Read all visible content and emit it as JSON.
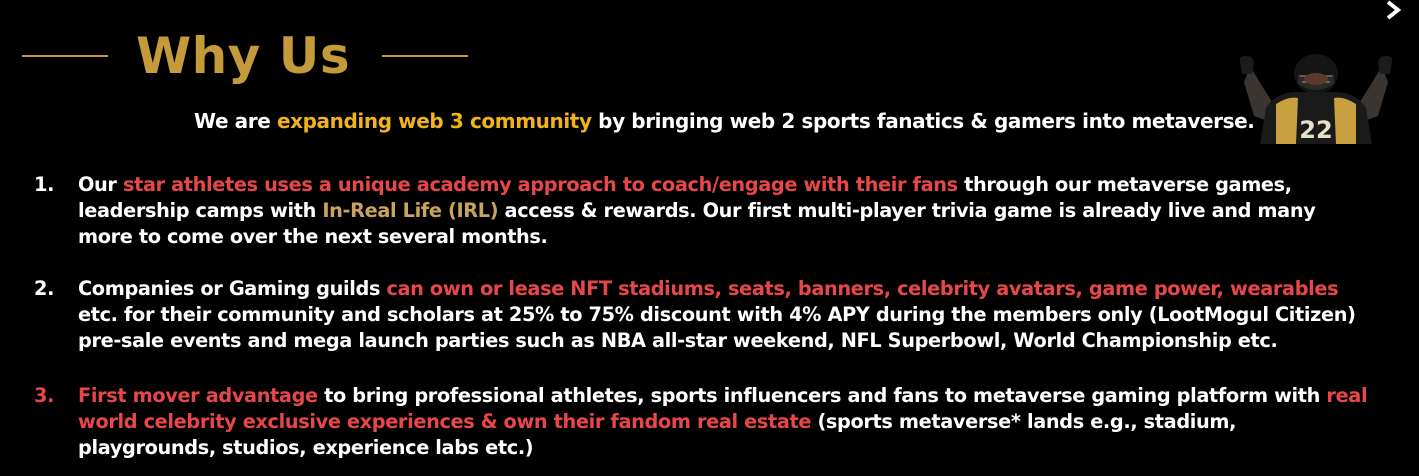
{
  "slide": {
    "title": "Why Us",
    "subtitle": {
      "prefix": "We are ",
      "highlight": "expanding web 3 community",
      "suffix": " by bringing web 2 sports fanatics & gamers into metaverse."
    },
    "jersey_number": "22",
    "colors": {
      "background": "#000000",
      "title_gold": "#c49a3a",
      "highlight_gold": "#f2b21b",
      "highlight_red": "#e8474a",
      "highlight_tan": "#c9a45c",
      "text": "#ffffff"
    },
    "icons": {
      "corner": "chevron-right-icon",
      "image": "football-player-image"
    },
    "points": [
      {
        "number": "1.",
        "line1_red": "star athletes uses a unique academy approach to coach/engage with their fans",
        "line1_prefix": "Our ",
        "line1_suffix": " through our metaverse games,",
        "line2_prefix": "leadership camps with ",
        "line2_tan": "In-Real Life (IRL)",
        "line2_suffix": " access & rewards. Our first multi-player trivia game is already live and many",
        "line3": "more to come over the next several months."
      },
      {
        "number": "2.",
        "line1_prefix": "Companies or Gaming guilds ",
        "line1_red": "can own or lease NFT stadiums, seats, banners, celebrity avatars, game power, wearables",
        "line2": "etc. for their community and scholars at 25% to 75% discount with 4% APY during the members only (LootMogul Citizen)",
        "line3": "pre-sale events and mega launch parties such as NBA all-star weekend, NFL Superbowl, World Championship etc."
      },
      {
        "number": "3.",
        "line1_red": "First mover advantage",
        "line1_middle": " to bring professional athletes, sports influencers and fans to metaverse gaming platform with ",
        "line1_red2": "real",
        "line2_red": "world celebrity exclusive experiences & own their fandom real estate",
        "line2_suffix": " (sports metaverse* lands e.g., stadium,",
        "line3": "playgrounds, studios, experience labs etc.)"
      }
    ]
  }
}
